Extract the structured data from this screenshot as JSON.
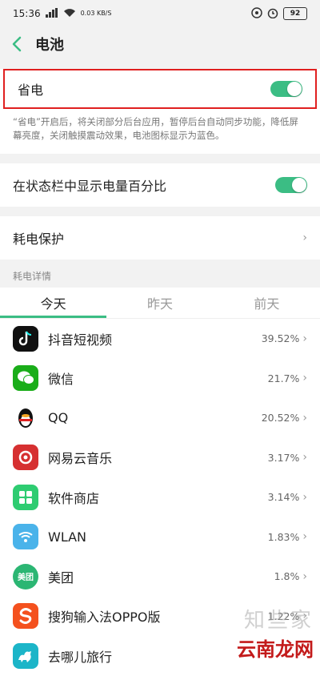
{
  "status_bar": {
    "time": "15:36",
    "signal": "5G",
    "net_speed": "0.03 KB/S",
    "battery": "92"
  },
  "header": {
    "title": "电池"
  },
  "power_saving": {
    "label": "省电",
    "enabled": true,
    "description": "“省电”开启后，将关闭部分后台应用，暂停后台自动同步功能，降低屏幕亮度，关闭触摸震动效果，电池图标显示为蓝色。"
  },
  "show_percentage": {
    "label": "在状态栏中显示电量百分比",
    "enabled": true
  },
  "protection": {
    "label": "耗电保护"
  },
  "details": {
    "section_label": "耗电详情",
    "tabs": [
      "今天",
      "昨天",
      "前天"
    ],
    "active_tab": 0,
    "apps": [
      {
        "name": "抖音短视频",
        "percent": "39.52%",
        "icon": "douyin-icon",
        "color": "#111111"
      },
      {
        "name": "微信",
        "percent": "21.7%",
        "icon": "wechat-icon",
        "color": "#1aad19"
      },
      {
        "name": "QQ",
        "percent": "20.52%",
        "icon": "qq-penguin-icon",
        "color": "#ffffff"
      },
      {
        "name": "网易云音乐",
        "percent": "3.17%",
        "icon": "netease-music-icon",
        "color": "#d63031"
      },
      {
        "name": "软件商店",
        "percent": "3.14%",
        "icon": "app-store-icon",
        "color": "#2ecc71"
      },
      {
        "name": "WLAN",
        "percent": "1.83%",
        "icon": "wifi-icon",
        "color": "#4ab3ea"
      },
      {
        "name": "美团",
        "percent": "1.8%",
        "icon": "meituan-icon",
        "color": "#2bb673"
      },
      {
        "name": "搜狗输入法OPPO版",
        "percent": "1.22%",
        "icon": "sogou-icon",
        "color": "#f4511e"
      },
      {
        "name": "去哪儿旅行",
        "percent": "1.13%",
        "icon": "qunar-icon",
        "color": "#1cb5c8"
      }
    ]
  },
  "colors": {
    "accent": "#3bbd84",
    "highlight": "#e02020"
  },
  "watermark": {
    "logo_text": "知些家",
    "site": "云南龙网"
  }
}
